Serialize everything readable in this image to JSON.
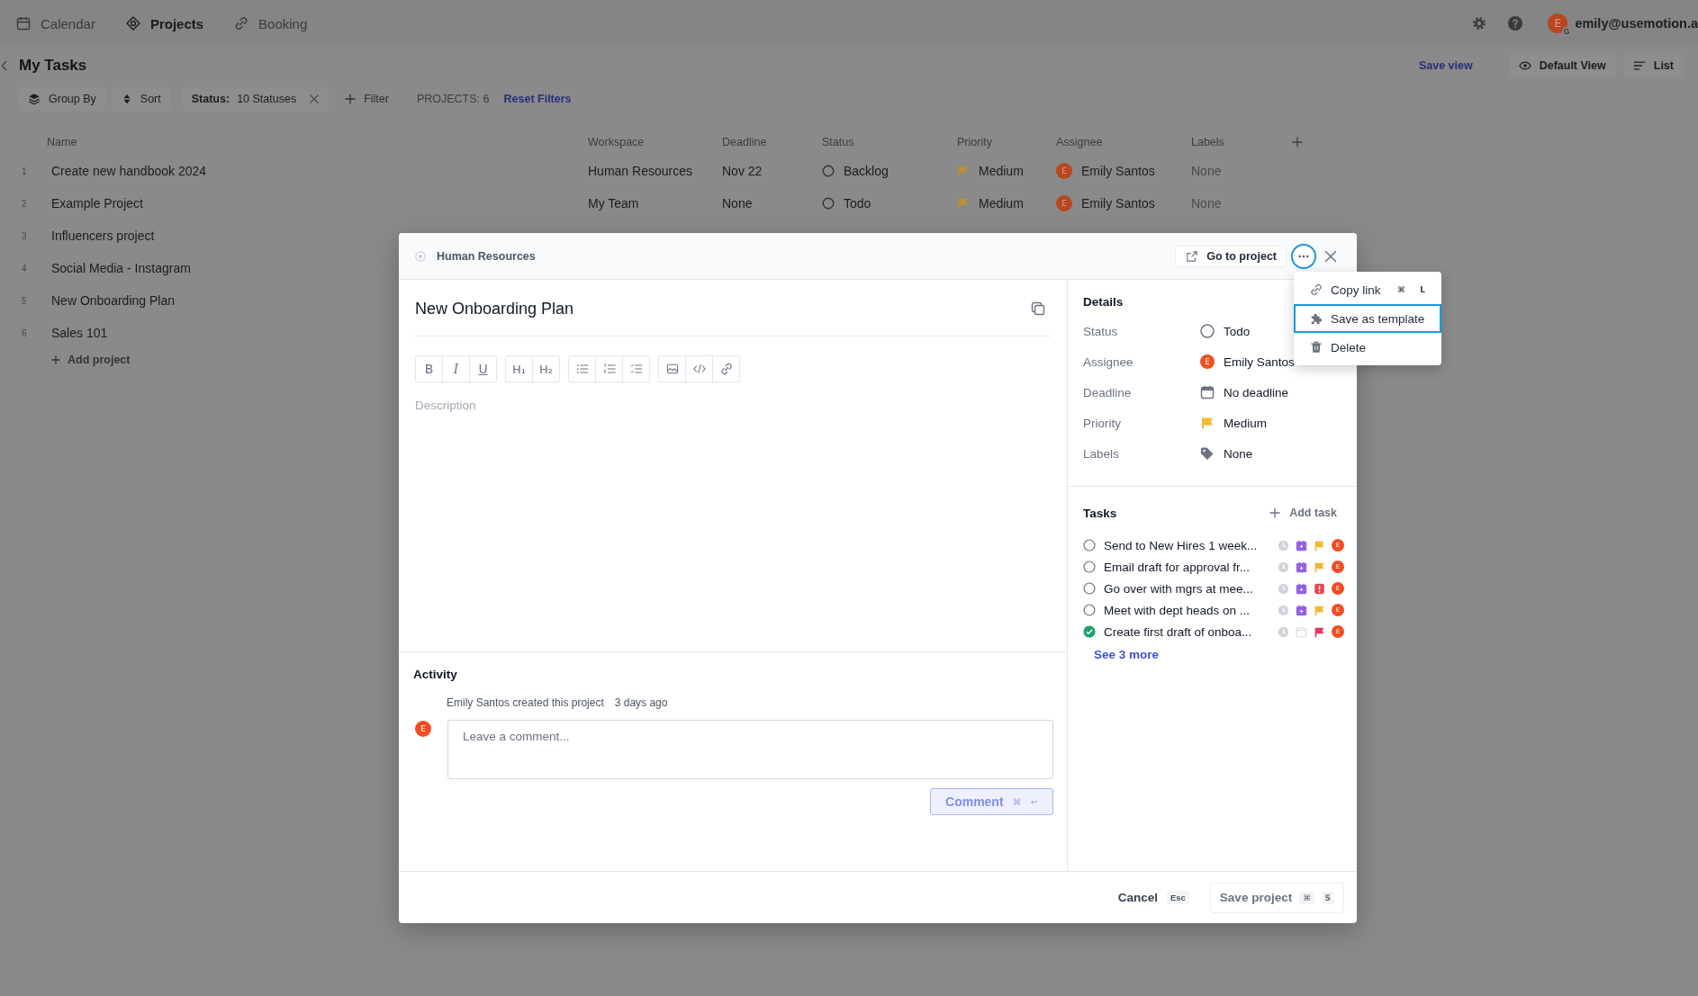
{
  "nav": {
    "items": [
      {
        "label": "Calendar",
        "selected": false
      },
      {
        "label": "Projects",
        "selected": true
      },
      {
        "label": "Booking",
        "selected": false
      }
    ],
    "account": {
      "initial": "E",
      "email": "emily@usemotion.a"
    }
  },
  "header": {
    "title": "My Tasks",
    "save_view": "Save view",
    "view": "Default View",
    "layout": "List"
  },
  "toolbar": {
    "group_by": "Group By",
    "sort": "Sort",
    "status_filter": {
      "label": "Status:",
      "value": "10 Statuses"
    },
    "filter": "Filter",
    "count": "PROJECTS: 6",
    "reset": "Reset Filters"
  },
  "table": {
    "columns": [
      "Name",
      "Workspace",
      "Deadline",
      "Status",
      "Priority",
      "Assignee",
      "Labels"
    ],
    "rows": [
      {
        "number": "1",
        "name": "Create new handbook 2024",
        "workspace": "Human Resources",
        "deadline": "Nov 22",
        "status": "Backlog",
        "priority": "Medium",
        "assignee": {
          "initial": "E",
          "name": "Emily Santos"
        },
        "labels": "None"
      },
      {
        "number": "2",
        "name": "Example Project",
        "workspace": "My Team",
        "deadline": "None",
        "status": "Todo",
        "priority": "Medium",
        "assignee": {
          "initial": "E",
          "name": "Emily Santos"
        },
        "labels": "None"
      },
      {
        "number": "3",
        "name": "Influencers project"
      },
      {
        "number": "4",
        "name": "Social Media - Instagram"
      },
      {
        "number": "5",
        "name": "New Onboarding Plan"
      },
      {
        "number": "6",
        "name": "Sales 101"
      }
    ],
    "add_project": "Add project"
  },
  "modal": {
    "workspace": "Human Resources",
    "go_to_project": "Go to project",
    "more_button": {
      "expanded": true
    },
    "title": "New Onboarding Plan",
    "editor_toolbar": [
      [
        {
          "kind": "bold",
          "label": "B"
        },
        {
          "kind": "italic",
          "label": "I"
        },
        {
          "kind": "underline",
          "label": "U"
        }
      ],
      [
        {
          "kind": "heading",
          "label": "H₁"
        },
        {
          "kind": "heading",
          "label": "H₂"
        }
      ],
      [
        {
          "kind": "bullet_list"
        },
        {
          "kind": "numbered_list"
        },
        {
          "kind": "check_list"
        }
      ],
      [
        {
          "kind": "image"
        },
        {
          "kind": "code"
        },
        {
          "kind": "link"
        }
      ]
    ],
    "description": {
      "placeholder": "Description"
    },
    "activity": {
      "heading": "Activity",
      "entries": [
        {
          "text": "Emily Santos created this project",
          "time": "3 days ago"
        }
      ],
      "comment": {
        "initial": "E",
        "placeholder": "Leave a comment...",
        "button": "Comment",
        "keys": [
          "⌘",
          "↵"
        ]
      }
    },
    "details": {
      "heading": "Details",
      "fields": [
        {
          "kind": "status",
          "label": "Status",
          "value": "Todo"
        },
        {
          "kind": "assignee",
          "label": "Assignee",
          "value": "Emily Santos",
          "initial": "E"
        },
        {
          "kind": "deadline",
          "label": "Deadline",
          "value": "No deadline"
        },
        {
          "kind": "priority",
          "label": "Priority",
          "value": "Medium"
        },
        {
          "kind": "labels",
          "label": "Labels",
          "value": "None"
        }
      ]
    },
    "tasks": {
      "heading": "Tasks",
      "add": "Add task",
      "items": [
        {
          "title": "Send to New Hires 1 week...",
          "checked": false,
          "scheduled": true,
          "priority": {
            "kind": "flag",
            "color": "#f5b731"
          },
          "initial": "E"
        },
        {
          "title": "Email draft for approval fr...",
          "checked": false,
          "scheduled": true,
          "priority": {
            "kind": "flag",
            "color": "#f5b731"
          },
          "initial": "E"
        },
        {
          "title": "Go over with mgrs at mee...",
          "checked": false,
          "scheduled": true,
          "priority": {
            "kind": "alert",
            "color": "#e5484d"
          },
          "initial": "E"
        },
        {
          "title": "Meet with dept heads on ...",
          "checked": false,
          "scheduled": true,
          "priority": {
            "kind": "flag",
            "color": "#f5b731"
          },
          "initial": "E"
        },
        {
          "title": "Create first draft of onboa...",
          "checked": true,
          "scheduled": false,
          "priority": {
            "kind": "flag",
            "color": "#e8385a"
          },
          "initial": "E"
        }
      ],
      "more": "See 3 more"
    },
    "footer": {
      "cancel": "Cancel",
      "cancel_key": "Esc",
      "save": "Save project",
      "save_keys": [
        "⌘",
        "S"
      ]
    }
  },
  "menu": {
    "items": [
      {
        "label": "Copy link",
        "keys": [
          "⌘",
          "L"
        ],
        "selected": false
      },
      {
        "label": "Save as template",
        "selected": true
      },
      {
        "label": "Delete",
        "selected": false
      }
    ]
  }
}
